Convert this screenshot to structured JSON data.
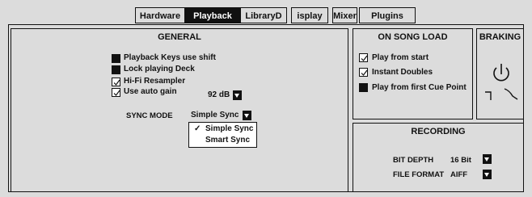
{
  "tabs": [
    {
      "label": "Hardware",
      "active": false
    },
    {
      "label": "Playback",
      "active": true
    },
    {
      "label": "LibraryD",
      "active": false
    },
    {
      "label": "isplay",
      "active": false
    },
    {
      "label": "Mixer",
      "active": false
    },
    {
      "label": "Plugins",
      "active": false
    }
  ],
  "general": {
    "title": "GENERAL",
    "options": [
      {
        "label": "Playback Keys use shift",
        "checked": false,
        "style": "filled"
      },
      {
        "label": "Lock playing Deck",
        "checked": false,
        "style": "filled"
      },
      {
        "label": "Hi-Fi Resampler",
        "checked": true,
        "style": "check"
      },
      {
        "label": "Use auto gain",
        "checked": true,
        "style": "check"
      }
    ],
    "auto_gain_value": "92 dB",
    "sync_mode_label": "SYNC MODE",
    "sync_mode_value": "Simple Sync",
    "sync_options": [
      {
        "label": "Simple Sync",
        "selected": true
      },
      {
        "label": "Smart Sync",
        "selected": false
      }
    ]
  },
  "song_load": {
    "title": "ON SONG LOAD",
    "options": [
      {
        "label": "Play from start",
        "checked": true
      },
      {
        "label": "Instant Doubles",
        "checked": true
      },
      {
        "label": "Play from first Cue Point",
        "checked": false
      }
    ]
  },
  "braking": {
    "title": "BRAKING"
  },
  "recording": {
    "title": "RECORDING",
    "bit_depth_label": "BIT DEPTH",
    "bit_depth_value": "16 Bit",
    "file_format_label": "FILE FORMAT",
    "file_format_value": "AIFF"
  }
}
